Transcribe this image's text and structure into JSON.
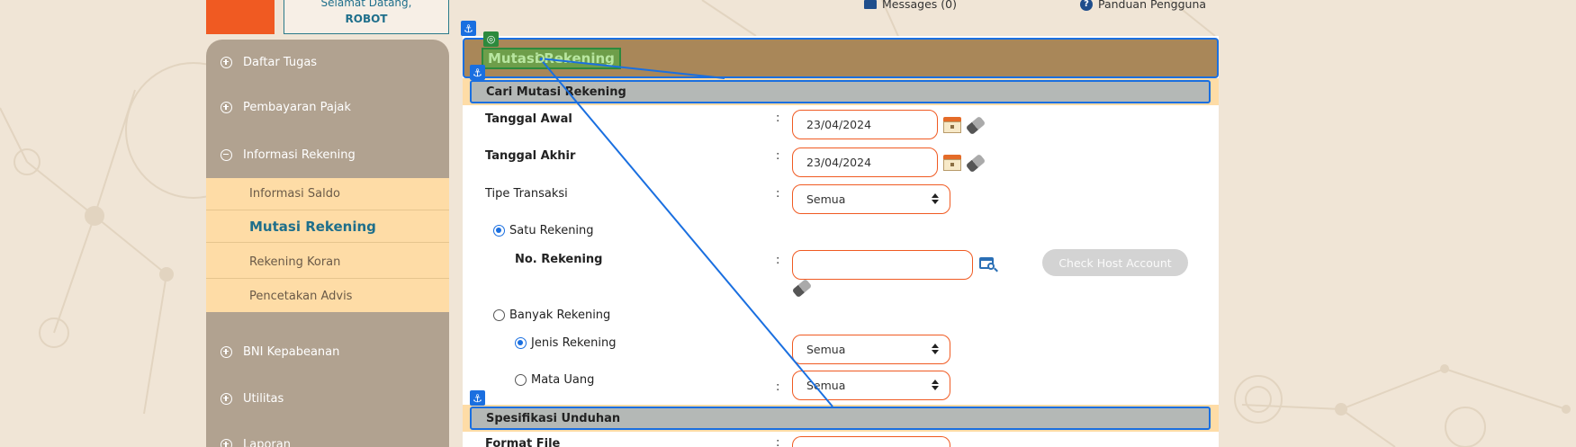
{
  "header": {
    "welcome_line": "Selamat Datang,",
    "user_name": "ROBOT",
    "messages_label": "Messages (0)",
    "guide_label": "Panduan Pengguna"
  },
  "sidebar": {
    "items": [
      {
        "label": "Daftar Tugas",
        "state": "collapsed"
      },
      {
        "label": "Pembayaran Pajak",
        "state": "collapsed"
      },
      {
        "label": "Informasi Rekening",
        "state": "expanded"
      },
      {
        "label": "BNI Kepabeanan",
        "state": "collapsed"
      },
      {
        "label": "Utilitas",
        "state": "collapsed"
      },
      {
        "label": "Laporan",
        "state": "collapsed"
      }
    ],
    "subitems": [
      {
        "label": "Informasi Saldo"
      },
      {
        "label": "Mutasi Rekening",
        "active": true
      },
      {
        "label": "Rekening Koran"
      },
      {
        "label": "Pencetakan Advis"
      }
    ]
  },
  "page": {
    "title": "Mutasi Rekening",
    "sections": {
      "search": "Cari Mutasi Rekening",
      "download": "Spesifikasi Unduhan"
    }
  },
  "form": {
    "colon": ":",
    "start_date": {
      "label": "Tanggal Awal",
      "value": "23/04/2024"
    },
    "end_date": {
      "label": "Tanggal Akhir",
      "value": "23/04/2024"
    },
    "transaction_type": {
      "label": "Tipe Transaksi",
      "value": "Semua"
    },
    "single_account": {
      "label": "Satu Rekening",
      "checked": true
    },
    "account_number": {
      "label": "No. Rekening",
      "value": ""
    },
    "check_host_button": "Check Host Account",
    "multiple_accounts": {
      "label": "Banyak Rekening",
      "checked": false
    },
    "account_type": {
      "label": "Jenis Rekening",
      "checked": true,
      "value": "Semua"
    },
    "currency": {
      "label": "Mata Uang",
      "checked": false,
      "value": "Semua"
    },
    "file_format": {
      "label": "Format File"
    }
  },
  "colors": {
    "accent_orange": "#f05a22",
    "sidebar_bg": "#b1a290",
    "submenu_bg": "#fedca6",
    "title_bar": "#a98759",
    "highlight_blue": "#1a6fe0",
    "active_teal": "#1f6f8b"
  }
}
